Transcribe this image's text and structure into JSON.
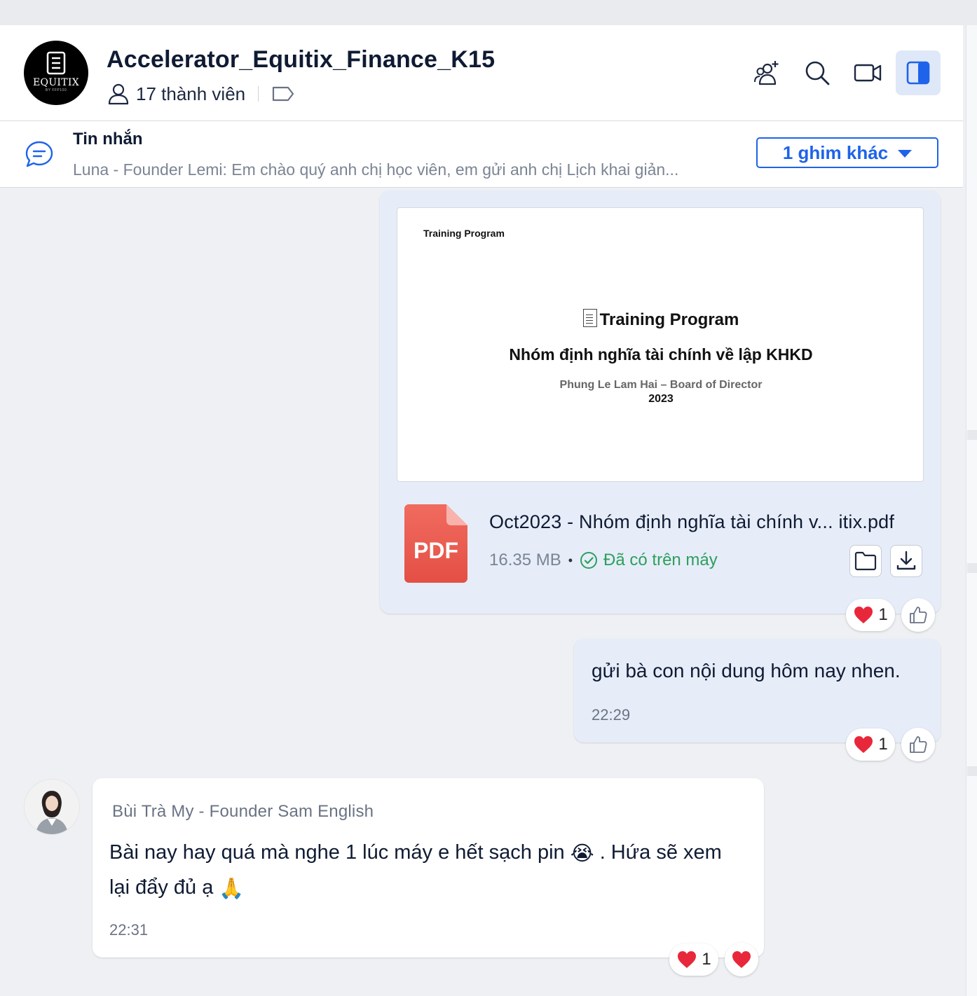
{
  "header": {
    "group_name": "Accelerator_Equitix_Finance_K15",
    "members": "17 thành viên",
    "logo_text": "EQUITIX",
    "logo_sub": "BY FFP100",
    "icons": [
      "add-member-icon",
      "search-icon",
      "video-call-icon",
      "sidebar-toggle-icon"
    ]
  },
  "pinned": {
    "title": "Tin nhắn",
    "preview": "Luna - Founder Lemi: Em chào quý anh chị học viên, em gửi anh chị  Lịch khai giản...",
    "more_label": "1 ghim khác"
  },
  "file_message": {
    "slide": {
      "corner": "Training Program",
      "title": "Training Program",
      "subtitle": "Nhóm định nghĩa tài chính về lập KHKD",
      "author": "Phung Le Lam Hai – Board of Director",
      "year": "2023"
    },
    "file_type": "PDF",
    "file_name": "Oct2023 - Nhóm định nghĩa tài chính v... itix.pdf",
    "size": "16.35 MB",
    "status": "Đã có trên máy",
    "reaction_count": "1"
  },
  "text_message": {
    "text": "gửi bà con nội dung hôm nay nhen.",
    "time": "22:29",
    "reaction_count": "1"
  },
  "other_message": {
    "sender": "Bùi Trà My - Founder Sam English",
    "text_part1": "Bài nay hay quá mà nghe 1 lúc máy e hết sạch pin",
    "emoji1": "😭",
    "text_part2": " . Hứa sẽ xem lại đẩy đủ ạ",
    "emoji2": "🙏",
    "time": "22:31",
    "reaction_count": "1"
  },
  "colors": {
    "accent": "#1e63e9",
    "my_bubble": "#e6edf9",
    "success": "#2e9e5b",
    "pdf_red": "#e5534b"
  }
}
